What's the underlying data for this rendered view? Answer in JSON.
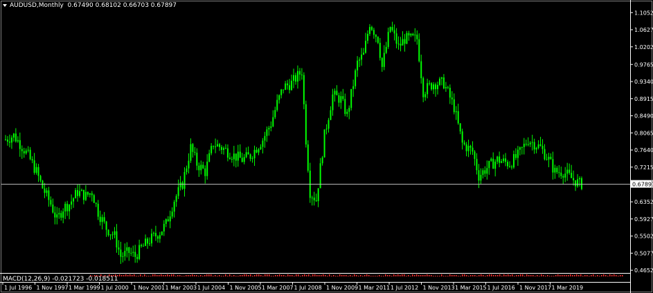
{
  "chart_data": {
    "type": "candlestick",
    "symbol_label": "AUDUSD,Monthly",
    "ohlc_label": "0.67490 0.68102 0.66703 0.67897",
    "current_price": 0.67897,
    "current_price_label": "0.67897",
    "y_ticks": [
      "1.10525",
      "1.06275",
      "1.02025",
      "0.97650",
      "0.93400",
      "0.89155",
      "0.84900",
      "0.80650",
      "0.76400",
      "0.72150",
      "0.67897",
      "0.63525",
      "0.59275",
      "0.55025",
      "0.50775",
      "0.46525"
    ],
    "y_tick_values": [
      1.10525,
      1.06275,
      1.02025,
      0.9765,
      0.934,
      0.89155,
      0.849,
      0.8065,
      0.764,
      0.7215,
      0.63525,
      0.59275,
      0.55025,
      0.50775,
      0.46525
    ],
    "ylim": [
      0.462,
      1.128
    ],
    "x_labels": [
      "1 Jul 1996",
      "1 Nov 1997",
      "1 Mar 1999",
      "1 Jul 2000",
      "1 Nov 2001",
      "1 Mar 2003",
      "1 Jul 2004",
      "1 Nov 2005",
      "1 Mar 2007",
      "1 Jul 2008",
      "1 Nov 2009",
      "1 Mar 2011",
      "1 Jul 2012",
      "1 Nov 2013",
      "1 Mar 2015",
      "1 Jul 2016",
      "1 Nov 2017",
      "1 Mar 2019"
    ],
    "close_path": [
      [
        "1996-07",
        0.79
      ],
      [
        "1996-11",
        0.8
      ],
      [
        "1997-02",
        0.78
      ],
      [
        "1997-06",
        0.75
      ],
      [
        "1997-10",
        0.71
      ],
      [
        "1998-01",
        0.67
      ],
      [
        "1998-05",
        0.63
      ],
      [
        "1998-08",
        0.59
      ],
      [
        "1998-11",
        0.62
      ],
      [
        "1999-02",
        0.63
      ],
      [
        "1999-06",
        0.66
      ],
      [
        "1999-10",
        0.65
      ],
      [
        "2000-01",
        0.66
      ],
      [
        "2000-04",
        0.61
      ],
      [
        "2000-08",
        0.57
      ],
      [
        "2000-12",
        0.55
      ],
      [
        "2001-03",
        0.5
      ],
      [
        "2001-07",
        0.51
      ],
      [
        "2001-10",
        0.5
      ],
      [
        "2002-01",
        0.52
      ],
      [
        "2002-05",
        0.54
      ],
      [
        "2002-10",
        0.56
      ],
      [
        "2003-01",
        0.58
      ],
      [
        "2003-05",
        0.64
      ],
      [
        "2003-09",
        0.68
      ],
      [
        "2004-01",
        0.77
      ],
      [
        "2004-04",
        0.73
      ],
      [
        "2004-08",
        0.71
      ],
      [
        "2004-12",
        0.78
      ],
      [
        "2005-04",
        0.77
      ],
      [
        "2005-10",
        0.75
      ],
      [
        "2006-02",
        0.74
      ],
      [
        "2006-06",
        0.75
      ],
      [
        "2006-12",
        0.79
      ],
      [
        "2007-04",
        0.83
      ],
      [
        "2007-07",
        0.88
      ],
      [
        "2007-10",
        0.92
      ],
      [
        "2008-02",
        0.93
      ],
      [
        "2008-07",
        0.96
      ],
      [
        "2008-09",
        0.79
      ],
      [
        "2008-11",
        0.66
      ],
      [
        "2009-02",
        0.64
      ],
      [
        "2009-06",
        0.8
      ],
      [
        "2009-10",
        0.9
      ],
      [
        "2010-02",
        0.89
      ],
      [
        "2010-05",
        0.85
      ],
      [
        "2010-10",
        0.98
      ],
      [
        "2011-01",
        1.0
      ],
      [
        "2011-04",
        1.08
      ],
      [
        "2011-08",
        1.04
      ],
      [
        "2011-10",
        0.97
      ],
      [
        "2012-02",
        1.07
      ],
      [
        "2012-06",
        1.02
      ],
      [
        "2012-09",
        1.04
      ],
      [
        "2013-03",
        1.04
      ],
      [
        "2013-06",
        0.91
      ],
      [
        "2013-11",
        0.93
      ],
      [
        "2014-04",
        0.93
      ],
      [
        "2014-09",
        0.87
      ],
      [
        "2015-01",
        0.78
      ],
      [
        "2015-06",
        0.76
      ],
      [
        "2015-09",
        0.7
      ],
      [
        "2016-01",
        0.72
      ],
      [
        "2016-06",
        0.74
      ],
      [
        "2016-12",
        0.73
      ],
      [
        "2017-04",
        0.75
      ],
      [
        "2017-09",
        0.79
      ],
      [
        "2017-12",
        0.78
      ],
      [
        "2018-03",
        0.77
      ],
      [
        "2018-07",
        0.74
      ],
      [
        "2018-10",
        0.71
      ],
      [
        "2019-02",
        0.71
      ],
      [
        "2019-07",
        0.69
      ],
      [
        "2019-10",
        0.68
      ]
    ],
    "grid": false,
    "indicator": {
      "name": "MACD",
      "label": "MACD(12,26,9) -0.021723 -0.018511"
    }
  },
  "colors": {
    "background": "#000000",
    "candle": "#00ff00",
    "axis": "#ffffff",
    "price_line": "#c0c0c0",
    "macd_dots": "#ff3030"
  }
}
